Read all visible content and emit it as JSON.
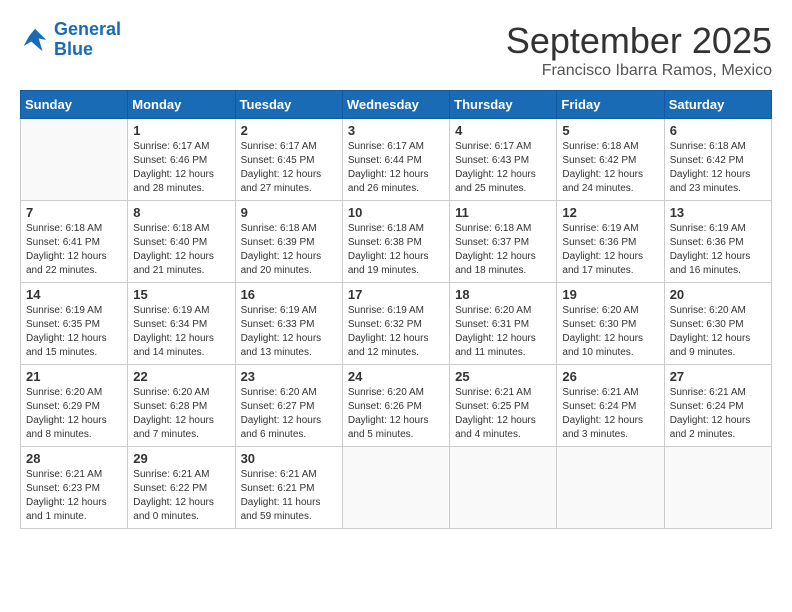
{
  "logo": {
    "line1": "General",
    "line2": "Blue"
  },
  "title": "September 2025",
  "subtitle": "Francisco Ibarra Ramos, Mexico",
  "weekdays": [
    "Sunday",
    "Monday",
    "Tuesday",
    "Wednesday",
    "Thursday",
    "Friday",
    "Saturday"
  ],
  "weeks": [
    [
      {
        "day": "",
        "content": ""
      },
      {
        "day": "1",
        "content": "Sunrise: 6:17 AM\nSunset: 6:46 PM\nDaylight: 12 hours\nand 28 minutes."
      },
      {
        "day": "2",
        "content": "Sunrise: 6:17 AM\nSunset: 6:45 PM\nDaylight: 12 hours\nand 27 minutes."
      },
      {
        "day": "3",
        "content": "Sunrise: 6:17 AM\nSunset: 6:44 PM\nDaylight: 12 hours\nand 26 minutes."
      },
      {
        "day": "4",
        "content": "Sunrise: 6:17 AM\nSunset: 6:43 PM\nDaylight: 12 hours\nand 25 minutes."
      },
      {
        "day": "5",
        "content": "Sunrise: 6:18 AM\nSunset: 6:42 PM\nDaylight: 12 hours\nand 24 minutes."
      },
      {
        "day": "6",
        "content": "Sunrise: 6:18 AM\nSunset: 6:42 PM\nDaylight: 12 hours\nand 23 minutes."
      }
    ],
    [
      {
        "day": "7",
        "content": "Sunrise: 6:18 AM\nSunset: 6:41 PM\nDaylight: 12 hours\nand 22 minutes."
      },
      {
        "day": "8",
        "content": "Sunrise: 6:18 AM\nSunset: 6:40 PM\nDaylight: 12 hours\nand 21 minutes."
      },
      {
        "day": "9",
        "content": "Sunrise: 6:18 AM\nSunset: 6:39 PM\nDaylight: 12 hours\nand 20 minutes."
      },
      {
        "day": "10",
        "content": "Sunrise: 6:18 AM\nSunset: 6:38 PM\nDaylight: 12 hours\nand 19 minutes."
      },
      {
        "day": "11",
        "content": "Sunrise: 6:18 AM\nSunset: 6:37 PM\nDaylight: 12 hours\nand 18 minutes."
      },
      {
        "day": "12",
        "content": "Sunrise: 6:19 AM\nSunset: 6:36 PM\nDaylight: 12 hours\nand 17 minutes."
      },
      {
        "day": "13",
        "content": "Sunrise: 6:19 AM\nSunset: 6:36 PM\nDaylight: 12 hours\nand 16 minutes."
      }
    ],
    [
      {
        "day": "14",
        "content": "Sunrise: 6:19 AM\nSunset: 6:35 PM\nDaylight: 12 hours\nand 15 minutes."
      },
      {
        "day": "15",
        "content": "Sunrise: 6:19 AM\nSunset: 6:34 PM\nDaylight: 12 hours\nand 14 minutes."
      },
      {
        "day": "16",
        "content": "Sunrise: 6:19 AM\nSunset: 6:33 PM\nDaylight: 12 hours\nand 13 minutes."
      },
      {
        "day": "17",
        "content": "Sunrise: 6:19 AM\nSunset: 6:32 PM\nDaylight: 12 hours\nand 12 minutes."
      },
      {
        "day": "18",
        "content": "Sunrise: 6:20 AM\nSunset: 6:31 PM\nDaylight: 12 hours\nand 11 minutes."
      },
      {
        "day": "19",
        "content": "Sunrise: 6:20 AM\nSunset: 6:30 PM\nDaylight: 12 hours\nand 10 minutes."
      },
      {
        "day": "20",
        "content": "Sunrise: 6:20 AM\nSunset: 6:30 PM\nDaylight: 12 hours\nand 9 minutes."
      }
    ],
    [
      {
        "day": "21",
        "content": "Sunrise: 6:20 AM\nSunset: 6:29 PM\nDaylight: 12 hours\nand 8 minutes."
      },
      {
        "day": "22",
        "content": "Sunrise: 6:20 AM\nSunset: 6:28 PM\nDaylight: 12 hours\nand 7 minutes."
      },
      {
        "day": "23",
        "content": "Sunrise: 6:20 AM\nSunset: 6:27 PM\nDaylight: 12 hours\nand 6 minutes."
      },
      {
        "day": "24",
        "content": "Sunrise: 6:20 AM\nSunset: 6:26 PM\nDaylight: 12 hours\nand 5 minutes."
      },
      {
        "day": "25",
        "content": "Sunrise: 6:21 AM\nSunset: 6:25 PM\nDaylight: 12 hours\nand 4 minutes."
      },
      {
        "day": "26",
        "content": "Sunrise: 6:21 AM\nSunset: 6:24 PM\nDaylight: 12 hours\nand 3 minutes."
      },
      {
        "day": "27",
        "content": "Sunrise: 6:21 AM\nSunset: 6:24 PM\nDaylight: 12 hours\nand 2 minutes."
      }
    ],
    [
      {
        "day": "28",
        "content": "Sunrise: 6:21 AM\nSunset: 6:23 PM\nDaylight: 12 hours\nand 1 minute."
      },
      {
        "day": "29",
        "content": "Sunrise: 6:21 AM\nSunset: 6:22 PM\nDaylight: 12 hours\nand 0 minutes."
      },
      {
        "day": "30",
        "content": "Sunrise: 6:21 AM\nSunset: 6:21 PM\nDaylight: 11 hours\nand 59 minutes."
      },
      {
        "day": "",
        "content": ""
      },
      {
        "day": "",
        "content": ""
      },
      {
        "day": "",
        "content": ""
      },
      {
        "day": "",
        "content": ""
      }
    ]
  ]
}
